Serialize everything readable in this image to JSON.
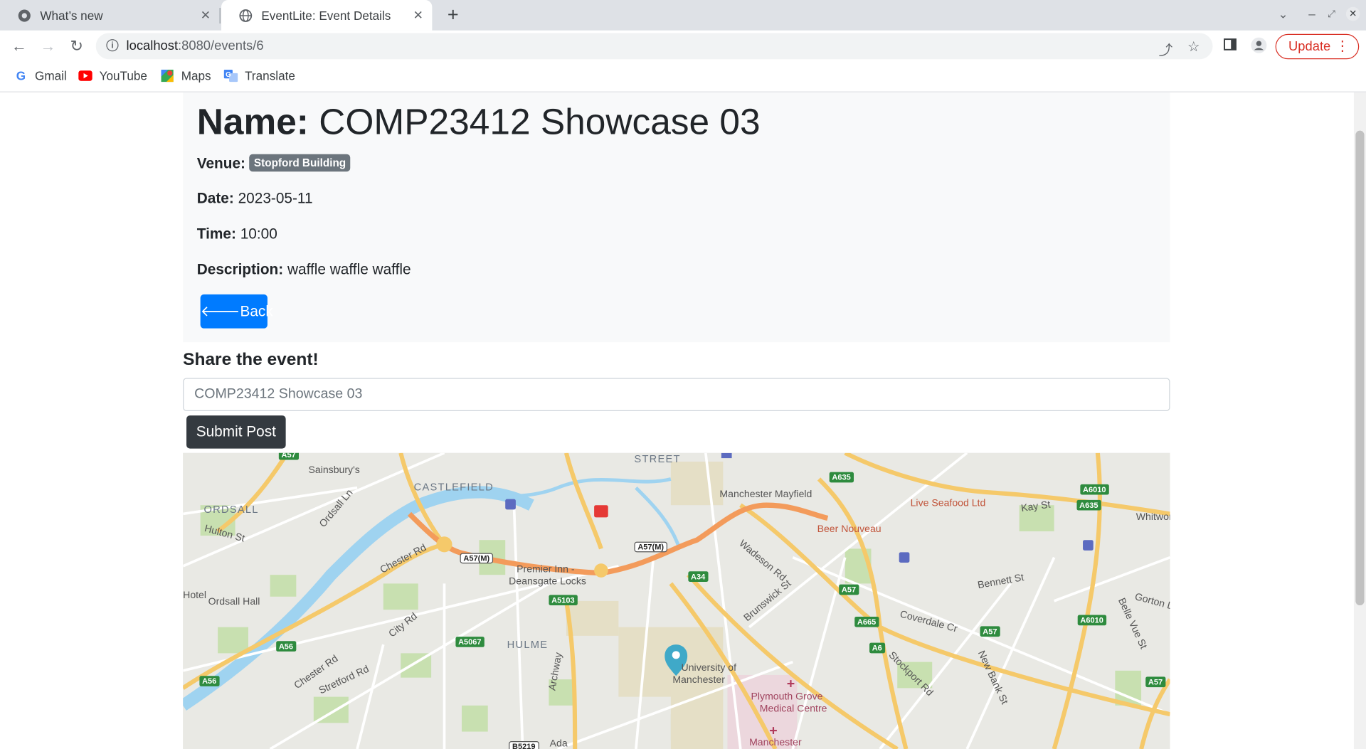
{
  "browser": {
    "tabs": [
      {
        "title": "What’s new"
      },
      {
        "title": "EventLite: Event Details"
      }
    ],
    "url_host": "localhost",
    "url_path": ":8080/events/6",
    "update_label": "Update"
  },
  "bookmarks": [
    {
      "label": "Gmail"
    },
    {
      "label": "YouTube"
    },
    {
      "label": "Maps"
    },
    {
      "label": "Translate"
    }
  ],
  "event": {
    "name_label": "Name:",
    "name": "COMP23412 Showcase 03",
    "venue_label": "Venue:",
    "venue": "Stopford Building",
    "date_label": "Date:",
    "date": "2023-05-11",
    "time_label": "Time:",
    "time": "10:00",
    "description_label": "Description:",
    "description": "waffle waffle waffle",
    "back_label": "Back"
  },
  "share": {
    "heading": "Share the event!",
    "input_value": "COMP23412 Showcase 03",
    "submit_label": "Submit Post"
  },
  "map": {
    "labels": {
      "castlefield": "CASTLEFIELD",
      "ordsall": "ORDSALL",
      "hulme": "HULME",
      "street": "STREET",
      "sainsburys": "Sainsbury's",
      "ordsall_ln": "Ordsall Ln",
      "hulton_st": "Hulton St",
      "chester_rd": "Chester Rd",
      "chester_rd2": "Chester Rd",
      "hotel": "Hotel",
      "ordsall_hall": "Ordsall Hall",
      "city_rd": "City Rd",
      "stretford_rd": "Stretford Rd",
      "premier_inn": "Premier Inn -",
      "deansgate_locks": "Deansgate Locks",
      "archway": "Archway",
      "university": "University of",
      "manchester": "Manchester",
      "plymouth": "Plymouth Grove",
      "medical": "Medical Centre",
      "manchester2": "Manchester",
      "mayfield": "Manchester Mayfield",
      "live_seafood": "Live Seafood Ltd",
      "beer_nouveau": "Beer Nouveau",
      "kay_st": "Kay St",
      "whitworth": "Whitworth",
      "wadeson_rd": "Wadeson Rd",
      "brunswick_st": "Brunswick St",
      "bennett_st": "Bennett St",
      "coverdale": "Coverdale Cr",
      "stockport_rd": "Stockport Rd",
      "new_bank_st": "New Bank St",
      "gorton": "Gorton L",
      "belle_vue": "Belle Vue St",
      "ada": "Ada"
    },
    "shields": {
      "a57m_1": "A57(M)",
      "a57m_2": "A57(M)",
      "a34": "A34",
      "a5103": "A5103",
      "a5067": "A5067",
      "a56": "A56",
      "a56b": "A56",
      "a57a": "A57",
      "a57b": "A57",
      "a57c": "A57",
      "a57top": "A57",
      "a665": "A665",
      "a6": "A6",
      "a635": "A635",
      "a635b": "A635",
      "a6010": "A6010",
      "a6010b": "A6010",
      "b5219": "B5219"
    }
  }
}
